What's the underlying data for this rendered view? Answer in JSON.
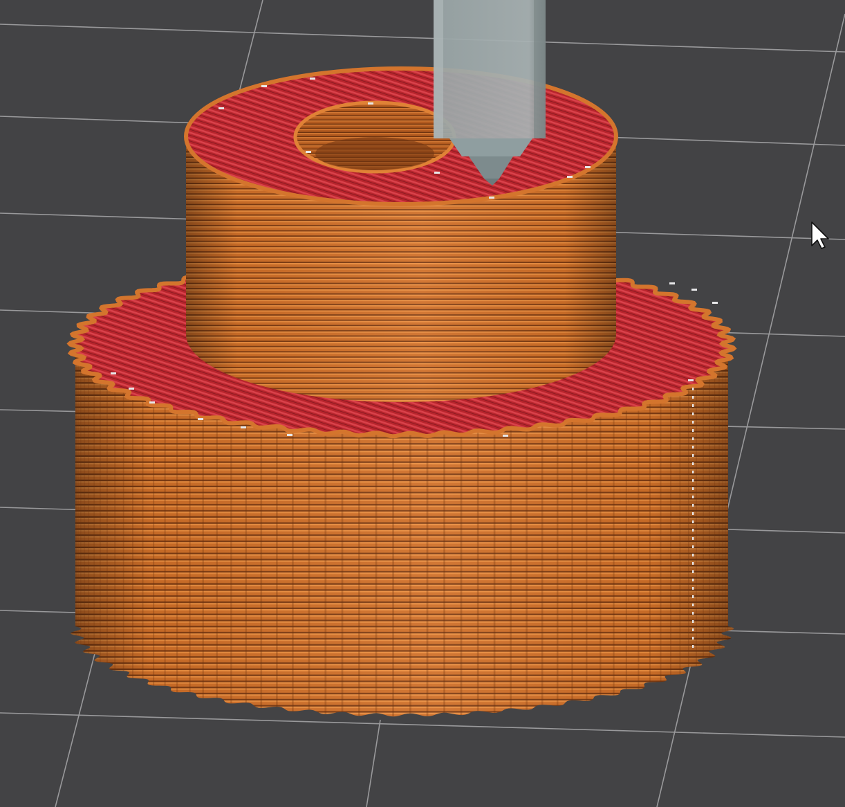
{
  "app": {
    "view": "gcode-preview",
    "colors": {
      "background": "#434345",
      "grid_line": "#a9a9ab",
      "perimeter": "#d4752d",
      "perimeter_dark": "#8f4718",
      "top_infill": "#b8252d",
      "top_infill_line": "#d9414a",
      "nozzle": "#8f9ea0",
      "nozzle_dark": "#6c7a7c",
      "seam": "#e8e8ea"
    }
  },
  "scene": {
    "objects": [
      {
        "name": "lower-tier",
        "outer_edge": "knurled",
        "top_surface": "solid-infill"
      },
      {
        "name": "upper-tier",
        "outer_edge": "smooth",
        "top_surface": "solid-infill",
        "center_hole": true
      }
    ],
    "toolhead": {
      "icon": "extruder-nozzle-icon"
    },
    "pointer": {
      "icon": "mouse-cursor-icon"
    }
  }
}
